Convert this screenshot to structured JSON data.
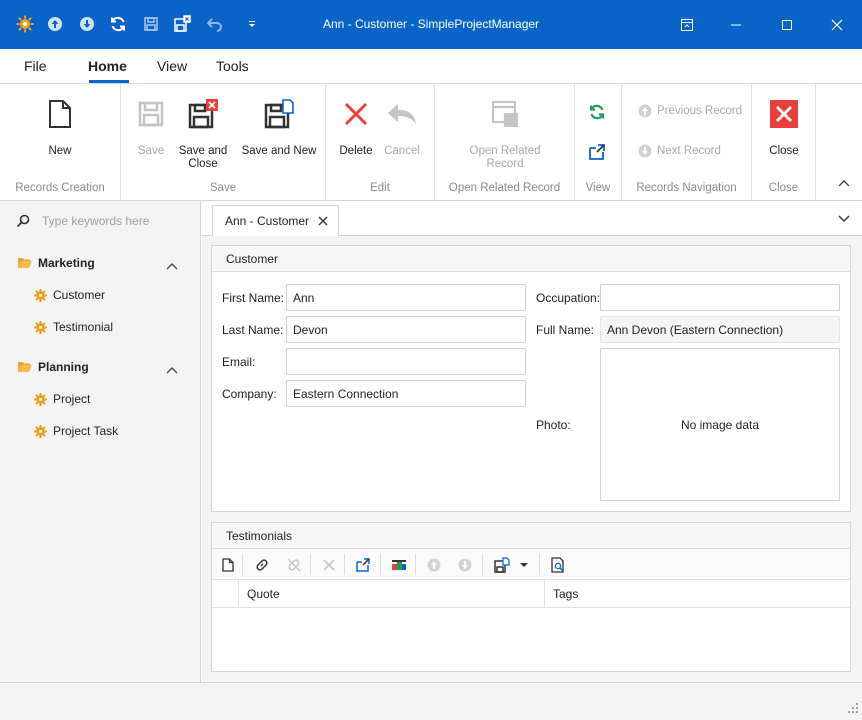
{
  "window": {
    "title": "Ann - Customer - SimpleProjectManager"
  },
  "menu": {
    "tabs": [
      {
        "label": "File"
      },
      {
        "label": "Home"
      },
      {
        "label": "View"
      },
      {
        "label": "Tools"
      }
    ]
  },
  "ribbon": {
    "groups": {
      "records_creation": "Records Creation",
      "save": "Save",
      "edit": "Edit",
      "open_related": "Open Related Record",
      "view": "View",
      "records_navigation": "Records Navigation",
      "close": "Close"
    },
    "buttons": {
      "new": "New",
      "save": "Save",
      "save_and_close_1": "Save and",
      "save_and_close_2": "Close",
      "save_and_new": "Save and New",
      "delete": "Delete",
      "cancel": "Cancel",
      "open_related_1": "Open Related",
      "open_related_2": "Record",
      "previous_record": "Previous Record",
      "next_record": "Next Record",
      "close": "Close"
    }
  },
  "sidebar": {
    "search_placeholder": "Type keywords here",
    "groups": [
      {
        "label": "Marketing",
        "items": [
          {
            "label": "Customer"
          },
          {
            "label": "Testimonial"
          }
        ]
      },
      {
        "label": "Planning",
        "items": [
          {
            "label": "Project"
          },
          {
            "label": "Project Task"
          }
        ]
      }
    ]
  },
  "document_tab": {
    "label": "Ann - Customer"
  },
  "customer": {
    "header": "Customer",
    "first_name_label": "First Name:",
    "first_name": "Ann",
    "last_name_label": "Last Name:",
    "last_name": "Devon",
    "email_label": "Email:",
    "email": "",
    "company_label": "Company:",
    "company": "Eastern Connection",
    "occupation_label": "Occupation:",
    "occupation": "",
    "full_name_label": "Full Name:",
    "full_name": "Ann Devon (Eastern Connection)",
    "photo_label": "Photo:",
    "photo_text": "No image data"
  },
  "testimonials": {
    "header": "Testimonials",
    "columns": [
      {
        "label": "Quote"
      },
      {
        "label": "Tags"
      }
    ]
  },
  "colors": {
    "accent": "#0a64c8",
    "delete_red": "#e8413c",
    "close_red": "#e8413c",
    "refresh_green": "#1e9e5a",
    "gear_orange": "#f39c12"
  }
}
